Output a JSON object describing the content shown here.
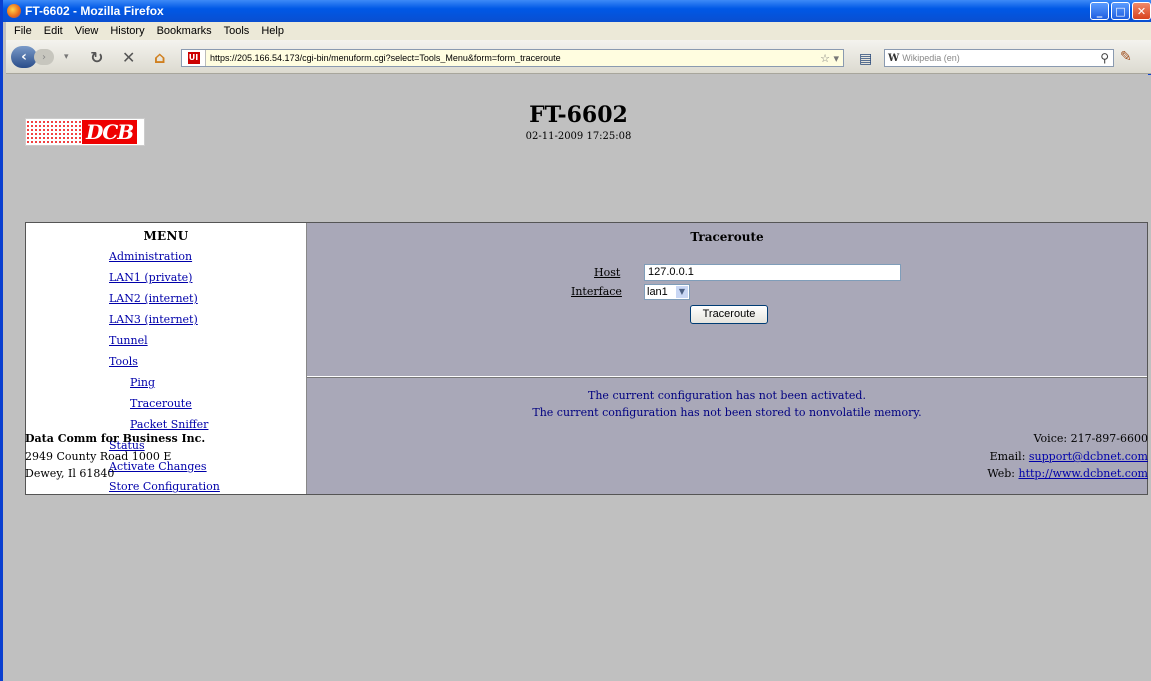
{
  "window": {
    "title": "FT-6602 - Mozilla Firefox"
  },
  "menubar": [
    "File",
    "Edit",
    "View",
    "History",
    "Bookmarks",
    "Tools",
    "Help"
  ],
  "navbar": {
    "url": "https://205.166.54.173/cgi-bin/menuform.cgi?select=Tools_Menu&form=form_traceroute",
    "search_engine": "W",
    "search_placeholder": "Wikipedia (en)"
  },
  "header": {
    "logo_text": "DCB",
    "title": "FT-6602",
    "datetime": "02-11-2009 17:25:08"
  },
  "menu": {
    "title": "MENU",
    "items": [
      "Administration",
      "LAN1 (private)",
      "LAN2 (internet)",
      "LAN3 (internet)",
      "Tunnel",
      "Tools"
    ],
    "tools_items": [
      "Ping",
      "Traceroute",
      "Packet Sniffer"
    ],
    "after_items": [
      "Status",
      "Activate Changes",
      "Store Configuration"
    ]
  },
  "form": {
    "title": "Traceroute",
    "host_label": "Host",
    "host_value": "127.0.0.1",
    "interface_label": "Interface",
    "interface_value": "lan1",
    "button": "Traceroute"
  },
  "messages": [
    "The current configuration has not been activated.",
    "The current configuration has not been stored to nonvolatile memory."
  ],
  "footer": {
    "company": "Data Comm for Business Inc.",
    "address1": "2949 County Road 1000 E",
    "address2": "Dewey, Il 61840",
    "voice": "Voice: 217-897-6600",
    "email_label": "Email:",
    "email": "support@dcbnet.com",
    "web_label": "Web:",
    "web": "http://www.dcbnet.com"
  }
}
